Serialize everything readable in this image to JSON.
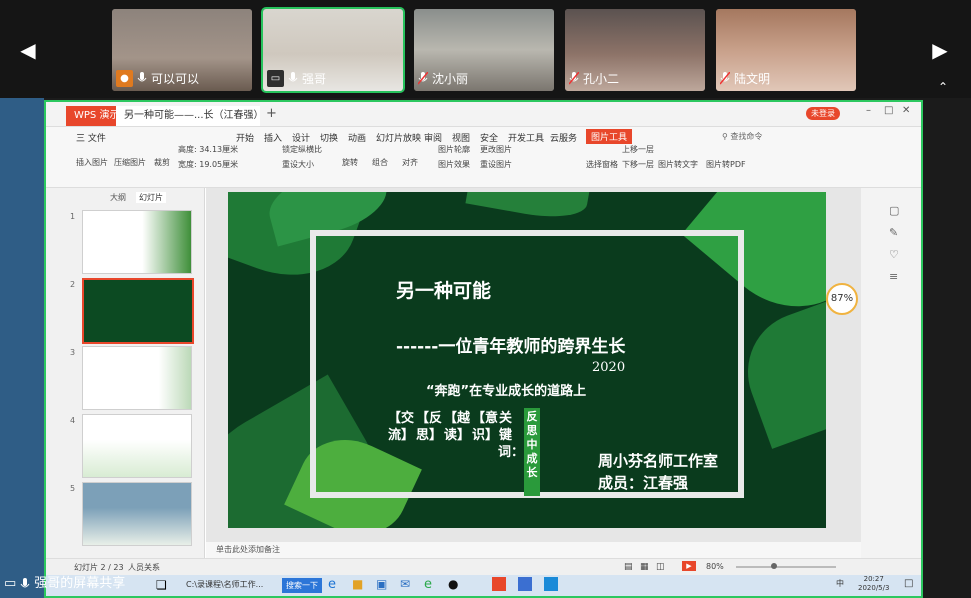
{
  "meeting": {
    "participants": [
      {
        "name": "可以可以",
        "badge": "person"
      },
      {
        "name": "强哥",
        "badge": "share"
      },
      {
        "name": "沈小丽",
        "badge": "mic-off"
      },
      {
        "name": "孔小二",
        "badge": "mic-off"
      },
      {
        "name": "陆文明",
        "badge": "mic-off"
      }
    ],
    "share_label": "强哥的屏幕共享"
  },
  "wps": {
    "app_tab": "WPS 演示",
    "doc_tab": "另一种可能——...长（江春强）",
    "login_label": "未登录",
    "menus": [
      "三 文件",
      "开始",
      "插入",
      "设计",
      "切换",
      "动画",
      "幻灯片放映",
      "审阅",
      "视图",
      "安全",
      "开发工具",
      "云服务",
      "图片工具"
    ],
    "search_placeholder": "查找命令",
    "ribbon_tools": [
      "插入图片",
      "压缩图片",
      "裁剪",
      "高度: 34.13厘米",
      "宽度: 19.05厘米",
      "锁定纵横比",
      "重设大小",
      "旋转",
      "组合",
      "对齐",
      "图片轮廓",
      "图片效果",
      "更改图片",
      "重设图片",
      "上移一层",
      "下移一层",
      "选择窗格",
      "图片转文字",
      "图片转PDF"
    ],
    "panel_tabs": [
      "大纲",
      "幻灯片"
    ],
    "slide_numbers": [
      "1",
      "2",
      "3",
      "4",
      "5"
    ],
    "notes_placeholder": "单击此处添加备注",
    "status_left": "幻灯片 2 / 23",
    "status_theme": "人员关系",
    "zoom": "80%",
    "zoom_badge": "87%"
  },
  "slide": {
    "title": "另一种可能",
    "subtitle": "------一位青年教师的跨界生长",
    "year": "2020",
    "tagline": "“奔跑”在专业成长的道路上",
    "keywords_label": "关键词：",
    "keywords": [
      "【交流】",
      "【反思】",
      "【越读】",
      "【意识】"
    ],
    "highlight": "反思中成长",
    "studio": "周小芬名师工作室",
    "member": "成员：江春强"
  },
  "taskbar": {
    "items": [
      "C:\\录课程\\名师工作...",
      "搜索一下"
    ],
    "clock_time": "20:27",
    "clock_date": "2020/5/3",
    "ime": "中"
  },
  "colors": {
    "accent_green": "#2cc75f",
    "slide_bg": "#0a3b1d",
    "highlight_green": "#2a9a3b",
    "wps_orange": "#e8472b"
  }
}
